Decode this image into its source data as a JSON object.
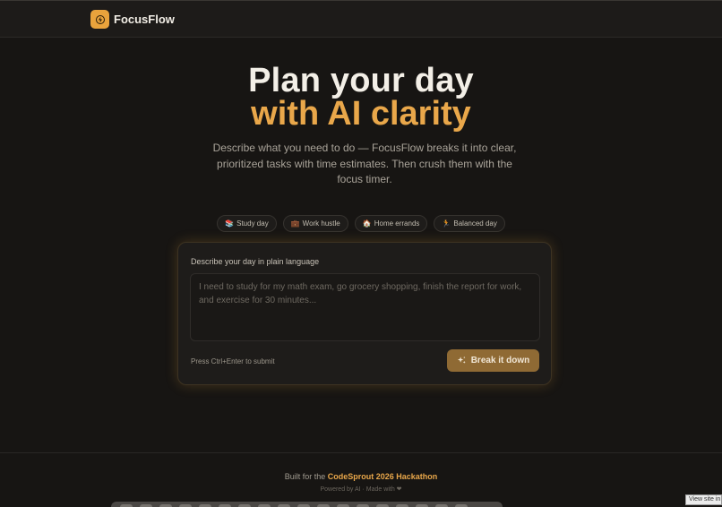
{
  "header": {
    "brand": "FocusFlow",
    "logo_icon": "lightning-bolt-icon",
    "accent_color": "#e9a33c"
  },
  "hero": {
    "title_line1": "Plan your day",
    "title_line2": "with AI clarity",
    "subtitle": "Describe what you need to do — FocusFlow breaks it into clear, prioritized tasks with time estimates. Then crush them with the focus timer."
  },
  "presets": [
    {
      "emoji": "📚",
      "label": "Study day"
    },
    {
      "emoji": "💼",
      "label": "Work hustle"
    },
    {
      "emoji": "🏠",
      "label": "Home errands"
    },
    {
      "emoji": "🏃",
      "label": "Balanced day"
    }
  ],
  "form": {
    "label": "Describe your day in plain language",
    "value": "",
    "placeholder": "I need to study for my math exam, go grocery shopping, finish the report for work, and exercise for 30 minutes...",
    "hint": "Press Ctrl+Enter to submit",
    "submit_label": "Break it down",
    "submit_icon": "sparkles-icon"
  },
  "footer": {
    "built_prefix": "Built for the",
    "hackathon": "CodeSprout 2026 Hackathon",
    "powered": "Powered by AI · Made with ❤"
  },
  "overlay": {
    "view_site": "View site in"
  }
}
